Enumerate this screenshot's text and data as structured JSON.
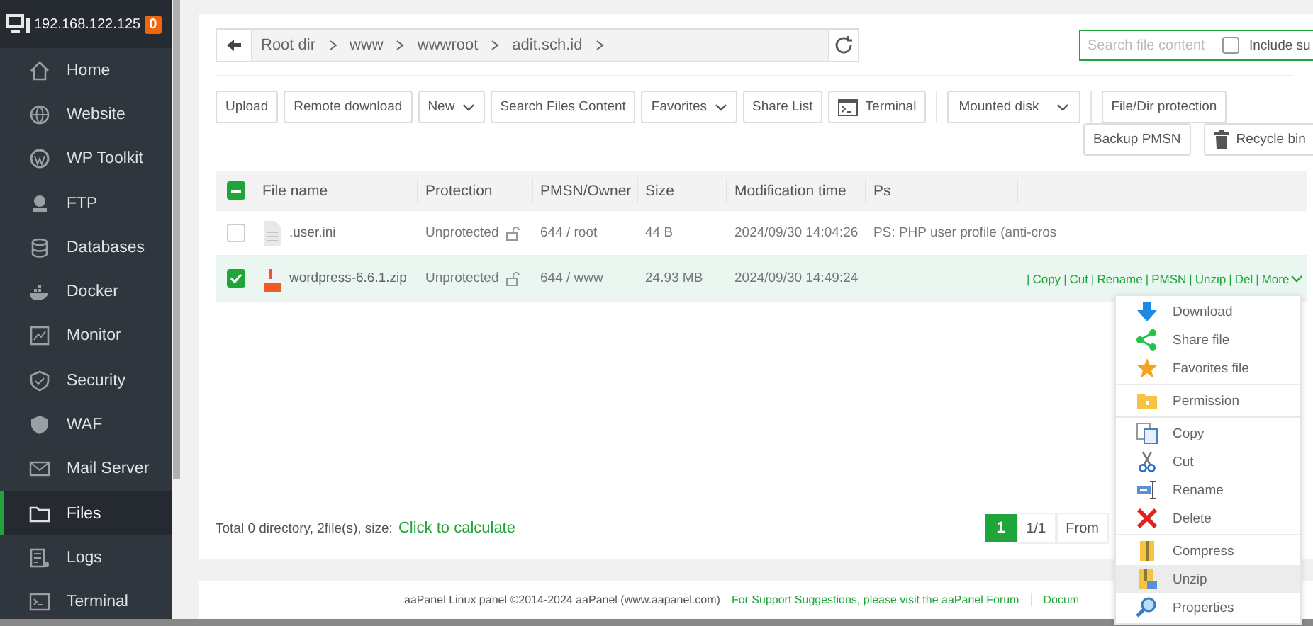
{
  "sidebar": {
    "host": "192.168.122.125",
    "badge": "0",
    "items": [
      {
        "label": "Home",
        "kind": "home",
        "selected": false
      },
      {
        "label": "Website",
        "kind": "globe",
        "selected": false
      },
      {
        "label": "WP Toolkit",
        "kind": "wp",
        "selected": false
      },
      {
        "label": "FTP",
        "kind": "ftp",
        "selected": false
      },
      {
        "label": "Databases",
        "kind": "database",
        "selected": false
      },
      {
        "label": "Docker",
        "kind": "docker",
        "selected": false
      },
      {
        "label": "Monitor",
        "kind": "monitor",
        "selected": false
      },
      {
        "label": "Security",
        "kind": "shield",
        "selected": false
      },
      {
        "label": "WAF",
        "kind": "waf",
        "selected": false
      },
      {
        "label": "Mail Server",
        "kind": "mail",
        "selected": false
      },
      {
        "label": "Files",
        "kind": "folder",
        "selected": true
      },
      {
        "label": "Logs",
        "kind": "logs",
        "selected": false
      },
      {
        "label": "Terminal",
        "kind": "terminal",
        "selected": false
      }
    ]
  },
  "breadcrumb": [
    "Root dir",
    "www",
    "wwwroot",
    "adit.sch.id"
  ],
  "search": {
    "placeholder": "Search file content",
    "include_label": "Include su",
    "include_checked": false
  },
  "toolbar": [
    {
      "label": "Upload",
      "kind": "plain"
    },
    {
      "label": "Remote download",
      "kind": "plain"
    },
    {
      "label": "New",
      "kind": "dropdown"
    },
    {
      "label": "Search Files Content",
      "kind": "plain"
    },
    {
      "label": "Favorites",
      "kind": "dropdown"
    },
    {
      "label": "Share List",
      "kind": "plain"
    },
    {
      "label": "Terminal",
      "kind": "terminal"
    },
    {
      "label": "Mounted disk",
      "kind": "select"
    },
    {
      "label": "File/Dir protection",
      "kind": "plain"
    }
  ],
  "toolbar_2": [
    {
      "label": "Backup PMSN",
      "kind": "plain"
    },
    {
      "label": "Recycle bin",
      "kind": "trash"
    }
  ],
  "table": {
    "select_all": {
      "partial": true
    },
    "columns": [
      "File name",
      "Protection",
      "PMSN/Owner",
      "Size",
      "Modification time",
      "Ps"
    ],
    "rows": [
      {
        "checked": false,
        "kind": "text",
        "name": ".user.ini",
        "protection": "Unprotected",
        "owner": "644 / root",
        "size": "44 B",
        "time": "2024/09/30 14:04:26",
        "ps": "PS: PHP user profile (anti-cros"
      },
      {
        "checked": true,
        "kind": "zip",
        "name": "wordpress-6.6.1.zip",
        "protection": "Unprotected",
        "owner": "644 / www",
        "size": "24.93 MB",
        "time": "2024/09/30 14:49:24",
        "ps": ""
      }
    ],
    "separator": "|",
    "actions": [
      "Copy",
      "Cut",
      "Rename",
      "PMSN",
      "Unzip",
      "Del",
      "More"
    ]
  },
  "summary": {
    "text": "Total 0 directory, 2file(s), size:",
    "link": "Click to calculate"
  },
  "pagination": {
    "current": "1",
    "pages": "1/1",
    "from": "From"
  },
  "footer": {
    "copyright": "aaPanel Linux panel ©2014-2024 aaPanel (www.aapanel.com)",
    "support": "For Support Suggestions, please visit the aaPanel Forum",
    "docs": "Docum"
  },
  "menu": {
    "groups": [
      [
        {
          "label": "Download",
          "kind": "download",
          "highlighted": false
        },
        {
          "label": "Share file",
          "kind": "share",
          "highlighted": false
        },
        {
          "label": "Favorites file",
          "kind": "star",
          "highlighted": false
        }
      ],
      [
        {
          "label": "Permission",
          "kind": "permission",
          "highlighted": false
        }
      ],
      [
        {
          "label": "Copy",
          "kind": "copy",
          "highlighted": false
        },
        {
          "label": "Cut",
          "kind": "cut",
          "highlighted": false
        },
        {
          "label": "Rename",
          "kind": "rename",
          "highlighted": false
        },
        {
          "label": "Delete",
          "kind": "delete",
          "highlighted": false
        }
      ],
      [
        {
          "label": "Compress",
          "kind": "compress",
          "highlighted": false
        },
        {
          "label": "Unzip",
          "kind": "unzip",
          "highlighted": true
        },
        {
          "label": "Properties",
          "kind": "properties",
          "highlighted": false
        }
      ]
    ]
  }
}
